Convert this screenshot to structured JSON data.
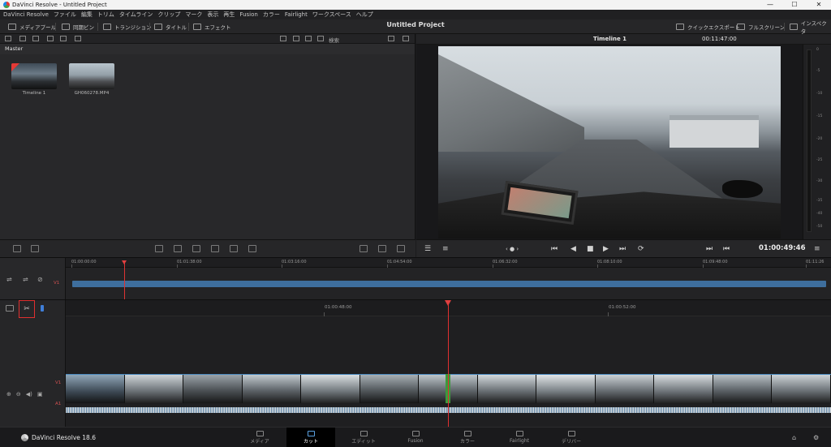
{
  "window": {
    "title": "DaVinci Resolve - Untitled Project",
    "controls": [
      "—",
      "☐",
      "✕"
    ]
  },
  "menu": [
    "DaVinci Resolve",
    "ファイル",
    "編集",
    "トリム",
    "タイムライン",
    "クリップ",
    "マーク",
    "表示",
    "再生",
    "Fusion",
    "カラー",
    "Fairlight",
    "ワークスペース",
    "ヘルプ"
  ],
  "toolbar": {
    "media_pool": "メディアプール",
    "sync_bin": "同期ビン",
    "transitions": "トランジション",
    "titles": "タイトル",
    "effects": "エフェクト",
    "project_title": "Untitled Project",
    "quick_export": "クイックエクスポート",
    "fullscreen": "フルスクリーン",
    "inspector": "インスペクタ"
  },
  "media_pool": {
    "search_label": "検索",
    "bin": "Master",
    "clips": [
      {
        "name": "Timeline 1"
      },
      {
        "name": "GH060278.MP4"
      }
    ]
  },
  "viewer": {
    "timeline_name": "Timeline 1",
    "duration": "00:11:47:00",
    "timecode": "01:00:49:46"
  },
  "audio_meter": {
    "ticks": [
      "0",
      "-5",
      "-10",
      "-15",
      "-20",
      "-25",
      "-30",
      "-35",
      "-40",
      "-50"
    ]
  },
  "upper_timeline": {
    "ruler": [
      "01:00:00:00",
      "01:01:38:00",
      "01:03:16:00",
      "01:04:54:00",
      "01:06:32:00",
      "01:08:10:00",
      "01:09:48:00",
      "01:11:26"
    ],
    "track": "V1"
  },
  "lower_timeline": {
    "ruler": [
      "01:00:48:00",
      "01:00:52:00"
    ],
    "video_track": "V1",
    "audio_track": "A1"
  },
  "pages": {
    "brand": "DaVinci Resolve 18.6",
    "tabs": [
      "メディア",
      "カット",
      "エディット",
      "Fusion",
      "カラー",
      "Fairlight",
      "デリバー"
    ],
    "active": "カット"
  },
  "colors": {
    "accent": "#e03030",
    "clip_blue": "#3e6e9d",
    "active_tab": "#5aa0e0"
  }
}
